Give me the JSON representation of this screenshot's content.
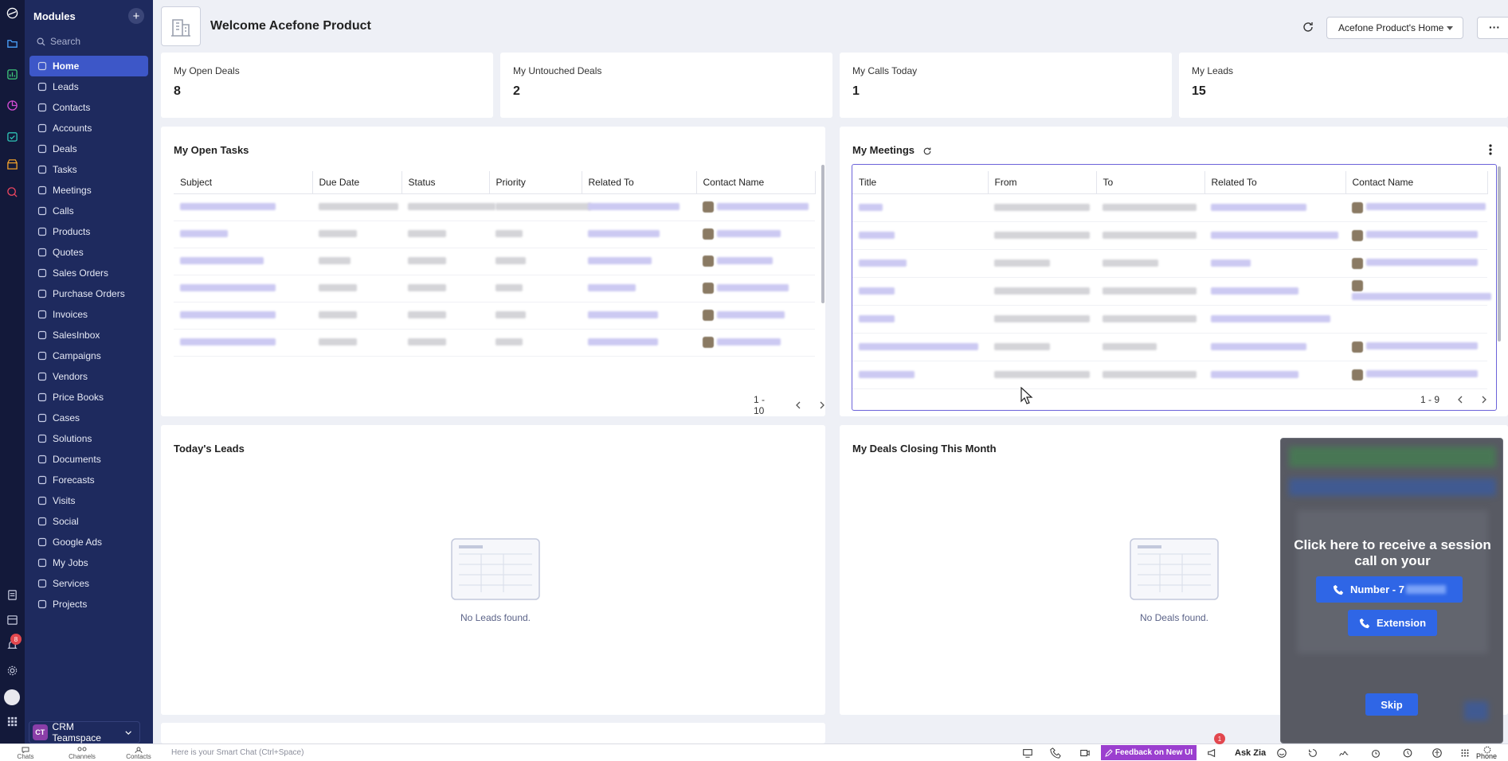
{
  "sidebar": {
    "title": "Modules",
    "search_placeholder": "Search",
    "items": [
      {
        "label": "Home",
        "icon": "home-icon"
      },
      {
        "label": "Leads",
        "icon": "leads-icon"
      },
      {
        "label": "Contacts",
        "icon": "contacts-icon"
      },
      {
        "label": "Accounts",
        "icon": "accounts-icon"
      },
      {
        "label": "Deals",
        "icon": "deals-icon"
      },
      {
        "label": "Tasks",
        "icon": "tasks-icon"
      },
      {
        "label": "Meetings",
        "icon": "meetings-icon"
      },
      {
        "label": "Calls",
        "icon": "calls-icon"
      },
      {
        "label": "Products",
        "icon": "products-icon"
      },
      {
        "label": "Quotes",
        "icon": "quotes-icon"
      },
      {
        "label": "Sales Orders",
        "icon": "sales-orders-icon"
      },
      {
        "label": "Purchase Orders",
        "icon": "purchase-orders-icon"
      },
      {
        "label": "Invoices",
        "icon": "invoices-icon"
      },
      {
        "label": "SalesInbox",
        "icon": "salesinbox-icon"
      },
      {
        "label": "Campaigns",
        "icon": "campaigns-icon"
      },
      {
        "label": "Vendors",
        "icon": "vendors-icon"
      },
      {
        "label": "Price Books",
        "icon": "price-books-icon"
      },
      {
        "label": "Cases",
        "icon": "cases-icon"
      },
      {
        "label": "Solutions",
        "icon": "solutions-icon"
      },
      {
        "label": "Documents",
        "icon": "documents-icon"
      },
      {
        "label": "Forecasts",
        "icon": "forecasts-icon"
      },
      {
        "label": "Visits",
        "icon": "visits-icon"
      },
      {
        "label": "Social",
        "icon": "social-icon"
      },
      {
        "label": "Google Ads",
        "icon": "google-ads-icon"
      },
      {
        "label": "My Jobs",
        "icon": "my-jobs-icon"
      },
      {
        "label": "Services",
        "icon": "services-icon"
      },
      {
        "label": "Projects",
        "icon": "projects-icon"
      }
    ],
    "teamspace_abbr": "CT",
    "teamspace": "CRM Teamspace"
  },
  "header": {
    "welcome": "Welcome Acefone Product",
    "home_selector": "Acefone Product's Home",
    "more": "···"
  },
  "kpis": [
    {
      "label": "My Open Deals",
      "value": "8"
    },
    {
      "label": "My Untouched Deals",
      "value": "2"
    },
    {
      "label": "My Calls Today",
      "value": "1"
    },
    {
      "label": "My Leads",
      "value": "15"
    }
  ],
  "tasks": {
    "title": "My Open Tasks",
    "columns": [
      "Subject",
      "Due Date",
      "Status",
      "Priority",
      "Related To",
      "Contact Name"
    ],
    "pager": "1 - 10"
  },
  "meetings": {
    "title": "My Meetings",
    "columns": [
      "Title",
      "From",
      "To",
      "Related To",
      "Contact Name"
    ],
    "pager": "1 - 9"
  },
  "leads": {
    "title": "Today's Leads",
    "empty": "No Leads found."
  },
  "deals": {
    "title": "My Deals Closing This Month",
    "empty": "No Deals found."
  },
  "zia_popup": {
    "message": "Click here to receive a session call on your",
    "number_label": "Number - 7",
    "extension_label": "Extension",
    "skip_label": "Skip"
  },
  "footer": {
    "chats": "Chats",
    "channels": "Channels",
    "contacts": "Contacts",
    "smart_chat": "Here is your Smart Chat (Ctrl+Space)",
    "feedback": "Feedback on New UI",
    "feedback_badge": "1",
    "ask_zia": "Ask Zia",
    "phone": "Phone"
  },
  "rail": {
    "notification_badge": "8"
  },
  "colors": {
    "sidebar": "#1e2a5e",
    "active": "#3d57c8",
    "accent_purple": "#9b3fcf",
    "button_blue": "#2f66e6"
  }
}
